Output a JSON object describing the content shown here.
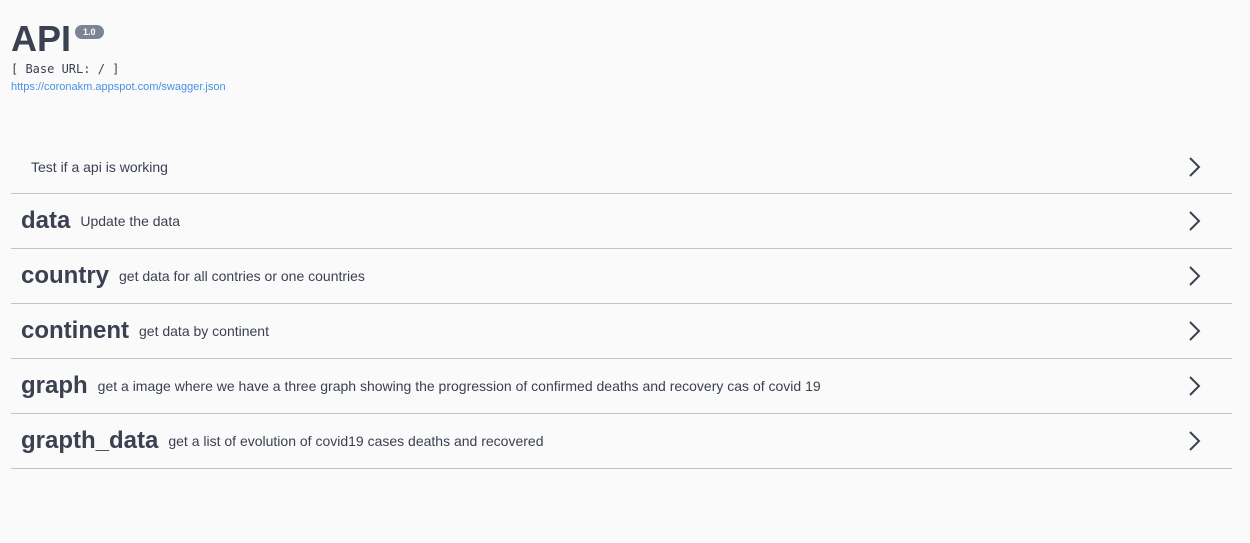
{
  "info": {
    "title": "API",
    "version": "1.0",
    "base_url": "[ Base URL: / ]",
    "spec_link": "https://coronakm.appspot.com/swagger.json"
  },
  "tags": [
    {
      "name": "",
      "description": "Test if a api is working"
    },
    {
      "name": "data",
      "description": "Update the data"
    },
    {
      "name": "country",
      "description": "get data for all contries or one countries"
    },
    {
      "name": "continent",
      "description": "get data by continent"
    },
    {
      "name": "graph",
      "description": "get a image where we have a three graph showing the progression of confirmed deaths and recovery cas of covid 19"
    },
    {
      "name": "grapth_data",
      "description": "get a list of evolution of covid19 cases deaths and recovered"
    }
  ],
  "icons": {
    "expand": "chevron-right-icon"
  },
  "colors": {
    "text": "#3b4151",
    "link": "#4990e2",
    "badge": "#7d8492",
    "divider": "#c3c3c3",
    "background": "#fafafa"
  }
}
